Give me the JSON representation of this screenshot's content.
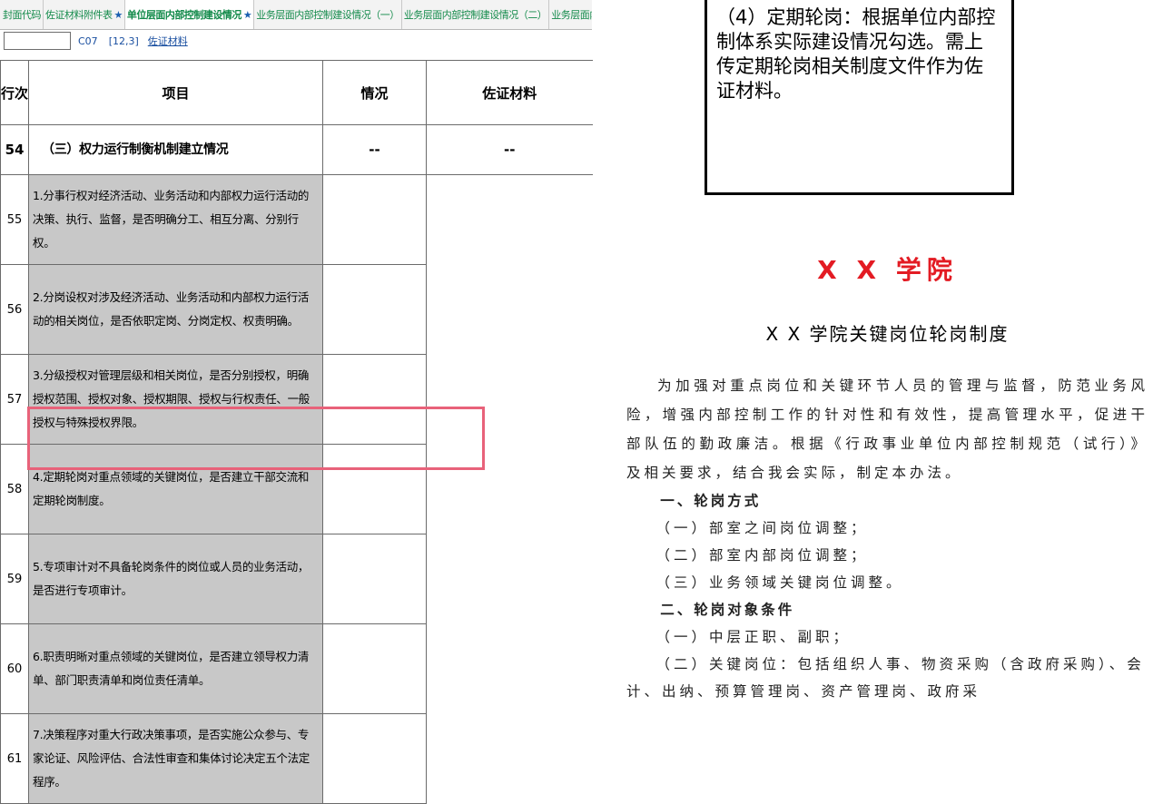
{
  "tabs": [
    {
      "label": "封面代码",
      "star": false
    },
    {
      "label": "佐证材料附件表",
      "star": true
    },
    {
      "label": "单位层面内部控制建设情况",
      "star": true
    },
    {
      "label": "业务层面内部控制建设情况（一）",
      "star": false
    },
    {
      "label": "业务层面内部控制建设情况（二）",
      "star": false
    },
    {
      "label": "业务层面内部控制建设情况（三）",
      "star": false
    }
  ],
  "formula_bar": {
    "cell_ref": "",
    "code": "C07",
    "coord": "[12,3]",
    "content": "佐证材料"
  },
  "table": {
    "headers": [
      "行次",
      "项目",
      "情况",
      "佐证材料"
    ],
    "section_row": {
      "num": "54",
      "label": "（三）权力运行制衡机制建立情况",
      "status": "--",
      "evidence": "--"
    },
    "rows": [
      {
        "num": "55",
        "text": "1.分事行权对经济活动、业务活动和内部权力运行活动的决策、执行、监督，是否明确分工、相互分离、分别行权。"
      },
      {
        "num": "56",
        "text": "2.分岗设权对涉及经济活动、业务活动和内部权力运行活动的相关岗位，是否依职定岗、分岗定权、权责明确。"
      },
      {
        "num": "57",
        "text": "3.分级授权对管理层级和相关岗位，是否分别授权，明确授权范围、授权对象、授权期限、授权与行权责任、一般授权与特殊授权界限。"
      },
      {
        "num": "58",
        "text": "4.定期轮岗对重点领域的关键岗位，是否建立干部交流和定期轮岗制度。"
      },
      {
        "num": "59",
        "text": "5.专项审计对不具备轮岗条件的岗位或人员的业务活动，是否进行专项审计。"
      },
      {
        "num": "60",
        "text": "6.职责明晰对重点领域的关键岗位，是否建立领导权力清单、部门职责清单和岗位责任清单。"
      },
      {
        "num": "61",
        "text": "7.决策程序对重大行政决策事项，是否实施公众参与、专家论证、风险评估、合法性审查和集体讨论决定五个法定程序。"
      }
    ]
  },
  "callout": {
    "text": "（4）定期轮岗：根据单位内部控制体系实际建设情况勾选。需上传定期轮岗相关制度文件作为佐证材料。"
  },
  "document": {
    "school": "X X 学院",
    "title": "X X 学院关键岗位轮岗制度",
    "intro": "为加强对重点岗位和关键环节人员的管理与监督，防范业务风险，增强内部控制工作的针对性和有效性，提高管理水平，促进干部队伍的勤政廉洁。根据《行政事业单位内部控制规范（试行）》及相关要求，结合我会实际，制定本办法。",
    "section1_title": "一、轮岗方式",
    "section1_items": [
      "（一）部室之间岗位调整；",
      "（二）部室内部岗位调整；",
      "（三）业务领域关键岗位调整。"
    ],
    "section2_title": "二、轮岗对象条件",
    "section2_item1": "（一）中层正职、副职；",
    "section2_item2": "（二）关键岗位：包括组织人事、物资采购（含政府采购）、会计、出纳、预算管理岗、资产管理岗、政府采"
  },
  "colors": {
    "tab_text": "#128a4a",
    "item_bg": "#c8c8c8",
    "highlight_border": "#e8627a",
    "school_red": "#e31b23"
  }
}
